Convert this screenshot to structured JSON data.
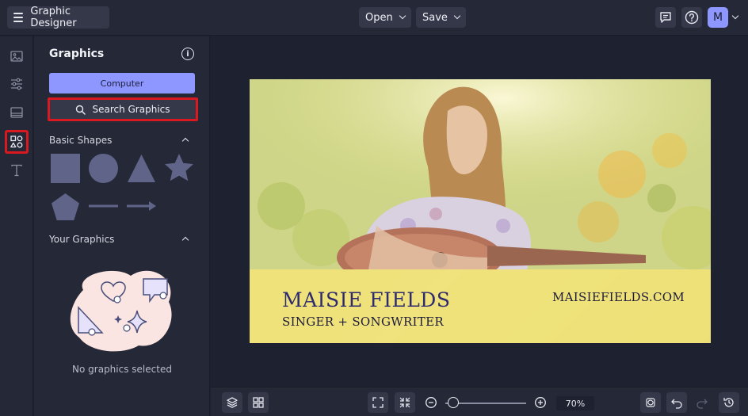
{
  "header": {
    "app_title": "Graphic Designer",
    "open_label": "Open",
    "save_label": "Save",
    "avatar_initial": "M"
  },
  "rail": {
    "items": [
      {
        "icon": "image-icon"
      },
      {
        "icon": "sliders-icon"
      },
      {
        "icon": "layout-icon"
      },
      {
        "icon": "shapes-icon",
        "active": true
      },
      {
        "icon": "text-icon"
      }
    ]
  },
  "panel": {
    "title": "Graphics",
    "computer_label": "Computer",
    "search_label": "Search Graphics",
    "basic_shapes_heading": "Basic Shapes",
    "your_graphics_heading": "Your Graphics",
    "empty_text": "No graphics selected",
    "shapes": [
      "square",
      "circle",
      "triangle",
      "star",
      "pentagon",
      "line",
      "arrow"
    ]
  },
  "artboard": {
    "name": "MAISIE FIELDS",
    "role": "SINGER + SONGWRITER",
    "url": "MAISIEFIELDS.COM"
  },
  "footer": {
    "zoom": "70%",
    "zoom_fraction": 0.1
  },
  "colors": {
    "accent": "#8e96ff",
    "highlight": "#d9191f",
    "panel_bg": "#252836",
    "canvas_bg": "#1e2130",
    "shape_fill": "#5f6488"
  }
}
